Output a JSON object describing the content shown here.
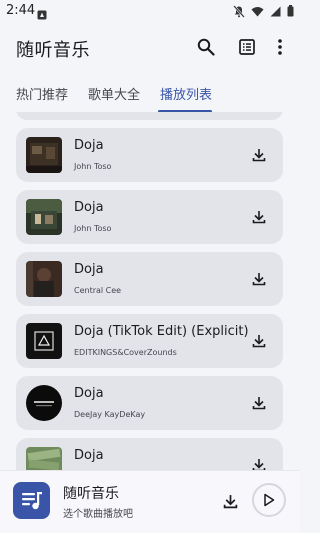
{
  "status_bar": {
    "time": "2:44"
  },
  "app_bar": {
    "title": "随听音乐"
  },
  "tabs": [
    {
      "label": "热门推荐",
      "active": false
    },
    {
      "label": "歌单大全",
      "active": false
    },
    {
      "label": "播放列表",
      "active": true
    }
  ],
  "songs": [
    {
      "title": "Doja",
      "artist": "John Toso"
    },
    {
      "title": "Doja",
      "artist": "John Toso"
    },
    {
      "title": "Doja",
      "artist": "Central Cee"
    },
    {
      "title": "Doja (TikTok Edit) (Explicit)",
      "artist": "EDITKINGS&CoverZounds"
    },
    {
      "title": "Doja",
      "artist": "DeeJay KayDeKay"
    },
    {
      "title": "Doja",
      "artist": ""
    }
  ],
  "player": {
    "title": "随听音乐",
    "subtitle": "选个歌曲播放吧"
  },
  "colors": {
    "accent": "#3a55a8",
    "card": "#e3e4ea",
    "background": "#f4f5f9"
  }
}
